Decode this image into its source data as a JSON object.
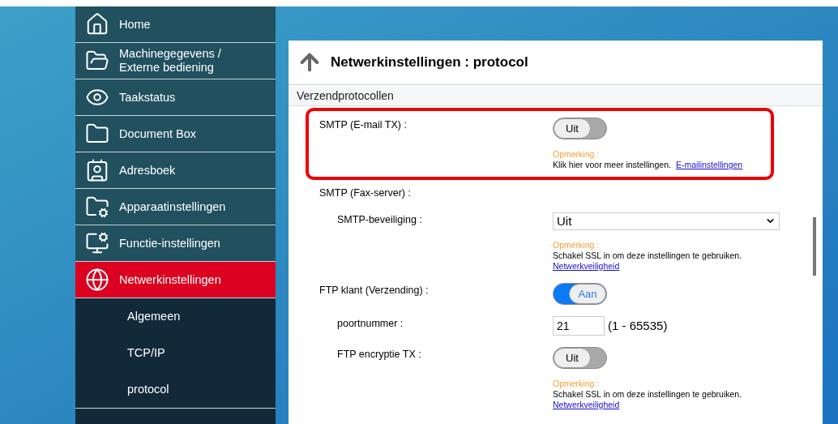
{
  "sidebar": {
    "items": [
      {
        "label": "Home",
        "selected": false
      },
      {
        "label": "Machinegegevens /\nExterne bediening",
        "selected": false
      },
      {
        "label": "Taakstatus",
        "selected": false
      },
      {
        "label": "Document Box",
        "selected": false
      },
      {
        "label": "Adresboek",
        "selected": false
      },
      {
        "label": "Apparaatinstellingen",
        "selected": false
      },
      {
        "label": "Functie-instellingen",
        "selected": false
      },
      {
        "label": "Netwerkinstellingen",
        "selected": true,
        "children": [
          {
            "label": "Algemeen",
            "selected": false
          },
          {
            "label": "TCP/IP",
            "selected": false
          },
          {
            "label": "protocol",
            "selected": false
          }
        ]
      }
    ]
  },
  "page": {
    "title": "Netwerkinstellingen : protocol",
    "section": "Verzendprotocollen",
    "rows": [
      {
        "kind": "toggle",
        "label": "SMTP (E-mail TX) :",
        "on": false,
        "toggle_label": "Uit",
        "highlighted": true,
        "note": {
          "title": "Opmerking :",
          "text": "Klik hier voor meer instellingen.",
          "link": "E-mailinstellingen"
        }
      },
      {
        "kind": "heading",
        "label": "SMTP (Fax-server) :",
        "highlighted": false,
        "children": [
          {
            "kind": "select",
            "label": "SMTP-beveiliging :",
            "value": "Uit",
            "note": {
              "title": "Opmerking :",
              "text": "Schakel SSL in om deze instellingen te gebruiken.",
              "link": "Netwerkveiligheid"
            }
          }
        ]
      },
      {
        "kind": "toggle",
        "label": "FTP klant (Verzending) :",
        "on": true,
        "toggle_label": "Aan",
        "highlighted": false,
        "children": [
          {
            "kind": "input",
            "label": "poortnummer :",
            "value": "21",
            "range": "(1 - 65535)"
          },
          {
            "kind": "toggle",
            "label": "FTP encryptie TX :",
            "on": false,
            "toggle_label": "Uit",
            "note": {
              "title": "Opmerking :",
              "text": "Schakel SSL in om deze instellingen te gebruiken.",
              "link": "Netwerkveiligheid"
            }
          }
        ]
      }
    ]
  }
}
